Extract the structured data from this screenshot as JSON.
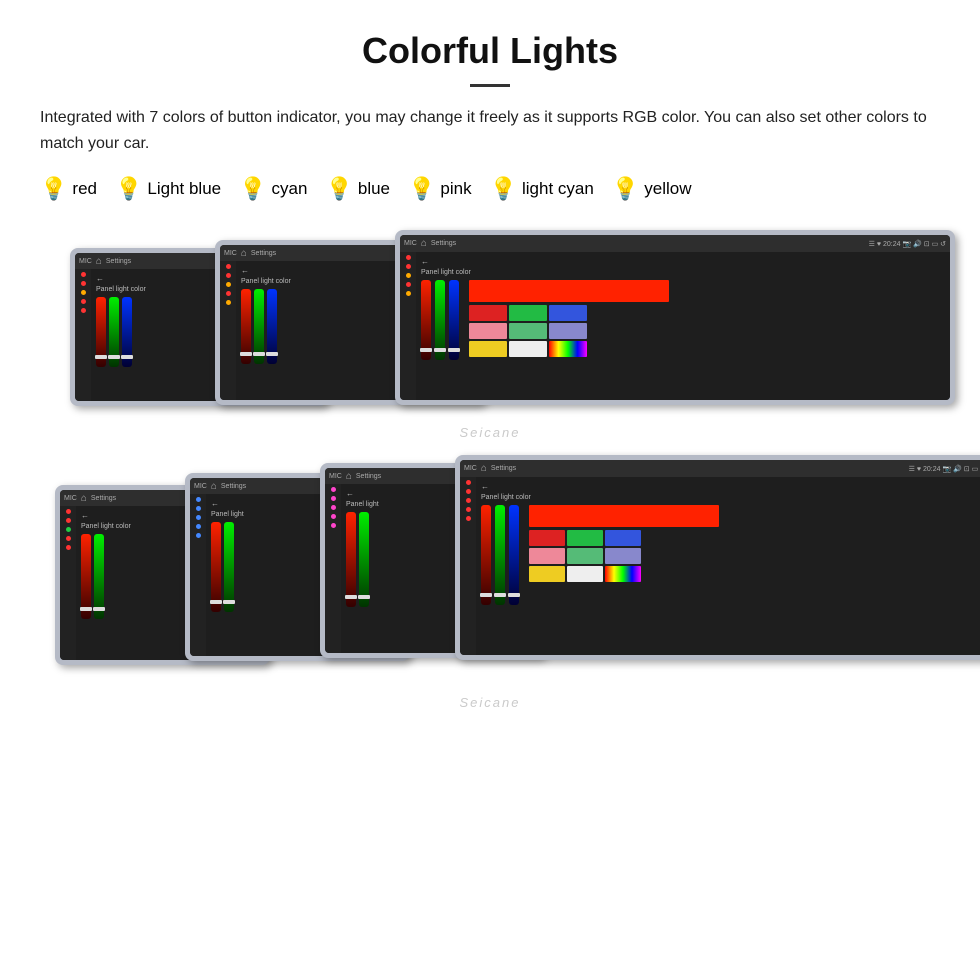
{
  "title": "Colorful Lights",
  "description": "Integrated with 7 colors of button indicator, you may change it freely as it supports RGB color. You can also set other colors to match your car.",
  "colors": [
    {
      "name": "red",
      "color": "#ff2222",
      "bulb": "💡"
    },
    {
      "name": "Light blue",
      "color": "#66aaff",
      "bulb": "💡"
    },
    {
      "name": "cyan",
      "color": "#00cccc",
      "bulb": "💡"
    },
    {
      "name": "blue",
      "color": "#3355ff",
      "bulb": "💡"
    },
    {
      "name": "pink",
      "color": "#ff44cc",
      "bulb": "💡"
    },
    {
      "name": "light cyan",
      "color": "#88dddd",
      "bulb": "💡"
    },
    {
      "name": "yellow",
      "color": "#ffee00",
      "bulb": "💡"
    }
  ],
  "watermark": "Seicane",
  "top_row": {
    "label": "top device row"
  },
  "bottom_row": {
    "label": "bottom device row"
  },
  "device": {
    "settings_label": "Settings",
    "panel_light_label": "Panel light color",
    "back_arrow": "←"
  }
}
